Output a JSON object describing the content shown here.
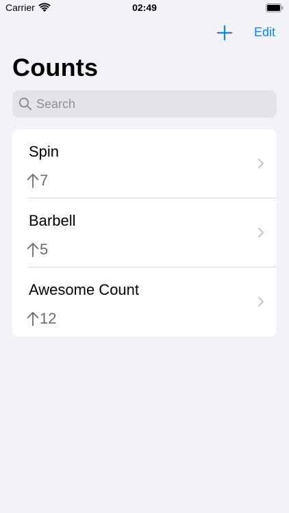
{
  "status_bar": {
    "carrier": "Carrier",
    "time": "02:49",
    "icons": [
      "wifi-icon",
      "battery-icon"
    ]
  },
  "nav": {
    "add_icon": "plus-icon",
    "edit_label": "Edit"
  },
  "page": {
    "title": "Counts"
  },
  "search": {
    "placeholder": "Search",
    "value": "",
    "icon": "search-icon"
  },
  "counts": [
    {
      "name": "Spin",
      "value": "7"
    },
    {
      "name": "Barbell",
      "value": "5"
    },
    {
      "name": "Awesome Count",
      "value": "12"
    }
  ],
  "colors": {
    "accent": "#0a84ff",
    "background": "#f2f2f7",
    "card": "#ffffff",
    "search_field": "#e3e3e8",
    "secondary_text": "#6c6c70"
  }
}
